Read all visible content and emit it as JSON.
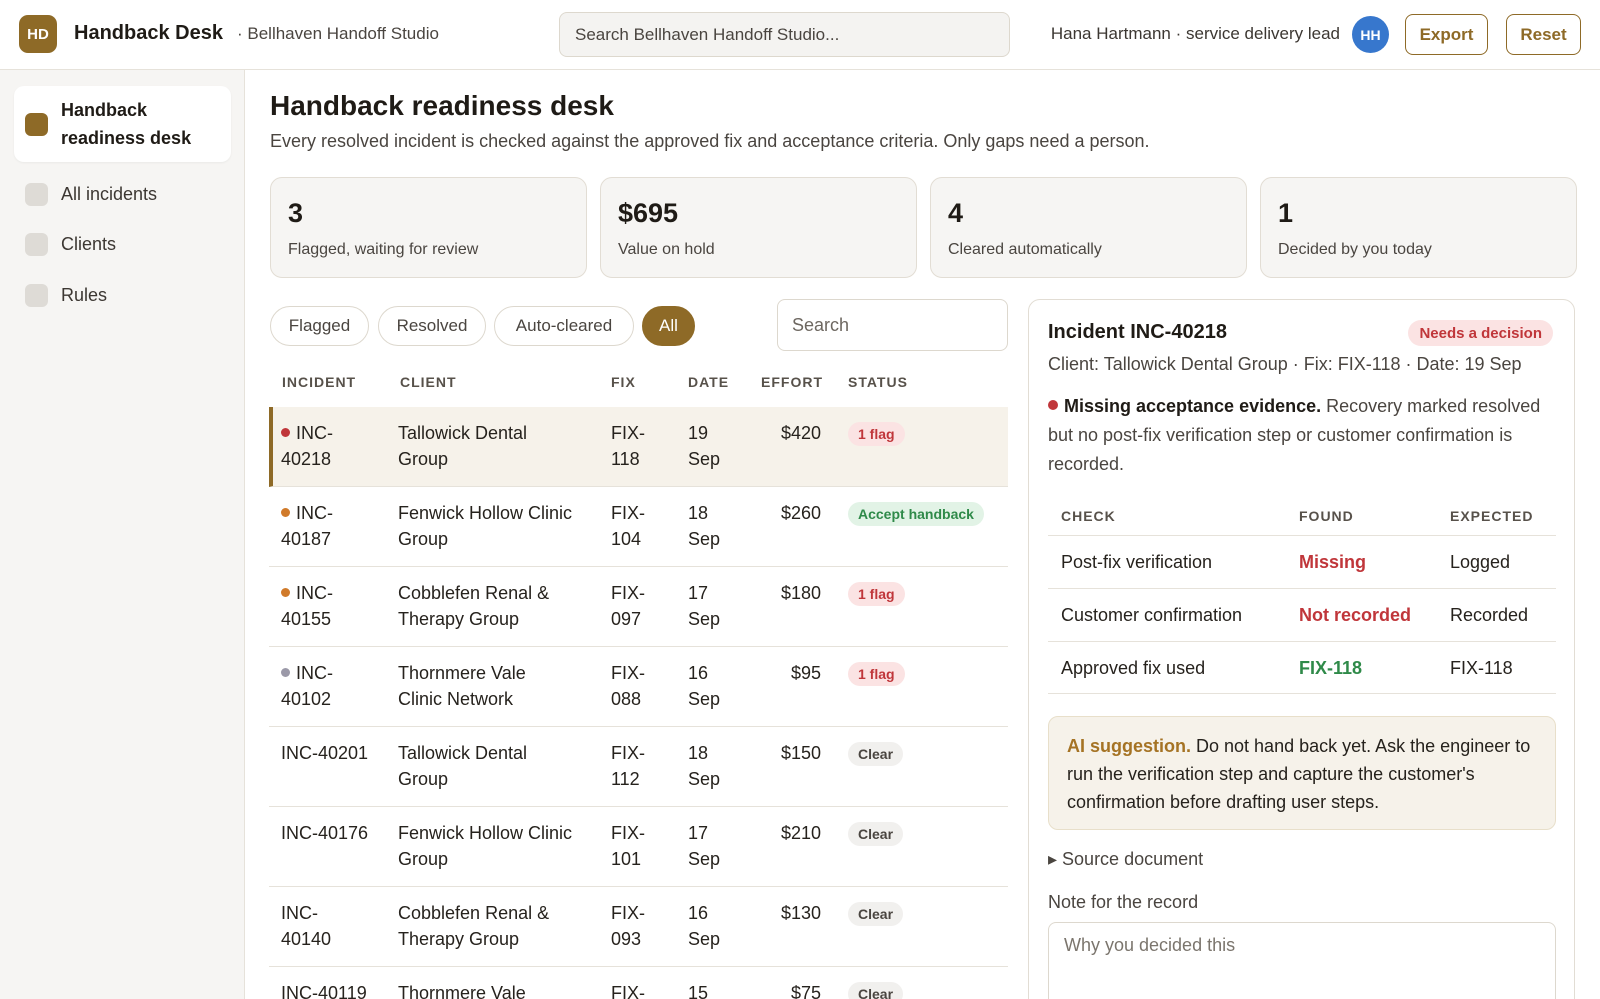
{
  "header": {
    "logo": "HD",
    "app_title": "Handback Desk",
    "workspace": "· Bellhaven Handoff Studio",
    "search_placeholder": "Search Bellhaven Handoff Studio...",
    "user": "Hana Hartmann · service delivery lead",
    "avatar": "HH",
    "export_label": "Export",
    "reset_label": "Reset"
  },
  "sidebar": {
    "items": [
      {
        "label": "Handback readiness desk",
        "active": true
      },
      {
        "label": "All incidents"
      },
      {
        "label": "Clients"
      },
      {
        "label": "Rules"
      }
    ]
  },
  "page": {
    "title": "Handback readiness desk",
    "subtitle": "Every resolved incident is checked against the approved fix and acceptance criteria. Only gaps need a person."
  },
  "stats": [
    {
      "value": "3",
      "label": "Flagged, waiting for review"
    },
    {
      "value": "$695",
      "label": "Value on hold"
    },
    {
      "value": "4",
      "label": "Cleared automatically"
    },
    {
      "value": "1",
      "label": "Decided by you today"
    }
  ],
  "filters": {
    "chips": [
      "Flagged",
      "Resolved",
      "Auto-cleared",
      "All"
    ],
    "active": "All",
    "search_placeholder": "Search"
  },
  "table": {
    "headers": [
      "INCIDENT",
      "CLIENT",
      "FIX",
      "DATE",
      "EFFORT",
      "STATUS"
    ],
    "rows": [
      {
        "id_a": "INC-",
        "id_b": "40218",
        "client_a": "Tallowick Dental",
        "client_b": "Group",
        "fix_a": "FIX-",
        "fix_b": "118",
        "date_a": "19",
        "date_b": "Sep",
        "effort": "$420",
        "status": "1 flag",
        "kind": "flag",
        "dot": "#c0363a"
      },
      {
        "id_a": "INC-",
        "id_b": "40187",
        "client_a": "Fenwick Hollow Clinic",
        "client_b": "Group",
        "fix_a": "FIX-",
        "fix_b": "104",
        "date_a": "18",
        "date_b": "Sep",
        "effort": "$260",
        "status": "Accept handback",
        "kind": "ok",
        "dot": "#d07a2a"
      },
      {
        "id_a": "INC-",
        "id_b": "40155",
        "client_a": "Cobblefen Renal &",
        "client_b": "Therapy Group",
        "fix_a": "FIX-",
        "fix_b": "097",
        "date_a": "17",
        "date_b": "Sep",
        "effort": "$180",
        "status": "1 flag",
        "kind": "flag",
        "dot": "#d07a2a"
      },
      {
        "id_a": "INC-",
        "id_b": "40102",
        "client_a": "Thornmere Vale",
        "client_b": "Clinic Network",
        "fix_a": "FIX-",
        "fix_b": "088",
        "date_a": "16",
        "date_b": "Sep",
        "effort": "$95",
        "status": "1 flag",
        "kind": "flag",
        "dot": "#9b99a8"
      },
      {
        "id_a": "INC-40201",
        "id_b": "",
        "client_a": "Tallowick Dental",
        "client_b": "Group",
        "fix_a": "FIX-",
        "fix_b": "112",
        "date_a": "18",
        "date_b": "Sep",
        "effort": "$150",
        "status": "Clear",
        "kind": "clear",
        "dot": ""
      },
      {
        "id_a": "INC-40176",
        "id_b": "",
        "client_a": "Fenwick Hollow Clinic",
        "client_b": "Group",
        "fix_a": "FIX-",
        "fix_b": "101",
        "date_a": "17",
        "date_b": "Sep",
        "effort": "$210",
        "status": "Clear",
        "kind": "clear",
        "dot": ""
      },
      {
        "id_a": "INC-",
        "id_b": "40140",
        "client_a": "Cobblefen Renal &",
        "client_b": "Therapy Group",
        "fix_a": "FIX-",
        "fix_b": "093",
        "date_a": "16",
        "date_b": "Sep",
        "effort": "$130",
        "status": "Clear",
        "kind": "clear",
        "dot": ""
      },
      {
        "id_a": "INC-40119",
        "id_b": "",
        "client_a": "Thornmere Vale",
        "client_b": "",
        "fix_a": "FIX-",
        "fix_b": "",
        "date_a": "15",
        "date_b": "",
        "effort": "$75",
        "status": "Clear",
        "kind": "clear",
        "dot": ""
      }
    ]
  },
  "detail": {
    "title": "Incident INC-40218",
    "badge": "Needs a decision",
    "meta": "Client: Tallowick Dental Group · Fix: FIX-118 · Date: 19 Sep",
    "issue_title": "Missing acceptance evidence.",
    "issue_text": " Recovery marked resolved but no post-fix verification step or customer confirmation is recorded.",
    "check_headers": [
      "CHECK",
      "FOUND",
      "EXPECTED"
    ],
    "checks": [
      {
        "check": "Post-fix verification",
        "found": "Missing",
        "expected": "Logged",
        "state": "bad"
      },
      {
        "check": "Customer confirmation",
        "found": "Not recorded",
        "expected": "Recorded",
        "state": "bad"
      },
      {
        "check": "Approved fix used",
        "found": "FIX-118",
        "expected": "FIX-118",
        "state": "good"
      }
    ],
    "ai_label": "AI suggestion.",
    "ai_text": " Do not hand back yet. Ask the engineer to run the verification step and capture the customer's confirmation before drafting user steps.",
    "source_label": "▸ Source document",
    "note_label": "Note for the record",
    "note_placeholder": "Why you decided this"
  }
}
